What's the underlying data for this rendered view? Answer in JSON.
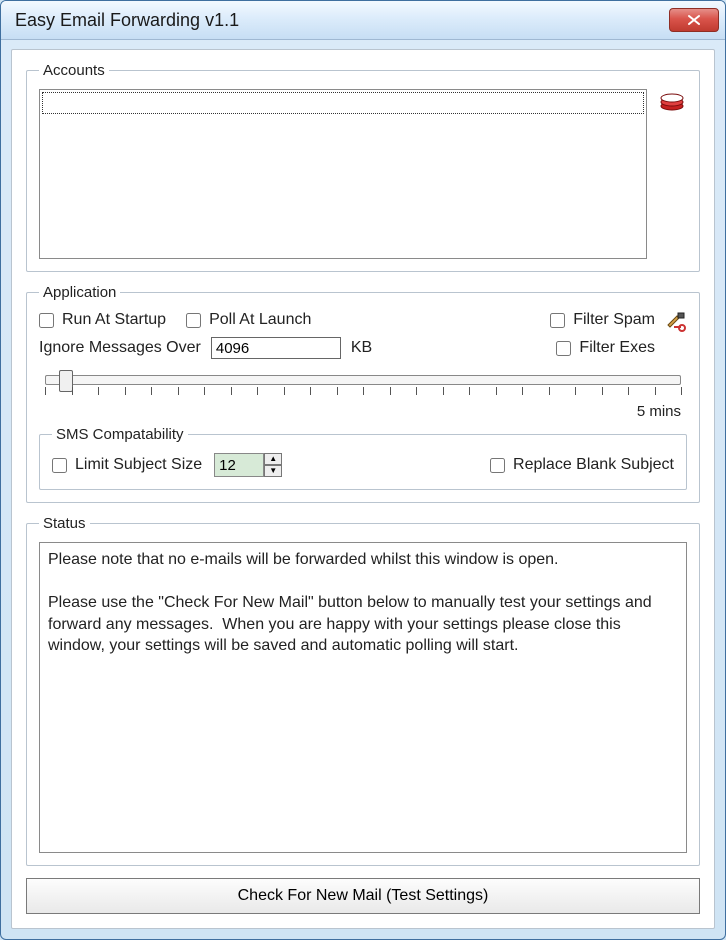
{
  "window": {
    "title": "Easy Email Forwarding v1.1"
  },
  "groups": {
    "accounts": "Accounts",
    "application": "Application",
    "sms": "SMS Compatability",
    "status": "Status"
  },
  "application": {
    "run_at_startup": "Run At Startup",
    "poll_at_launch": "Poll At Launch",
    "filter_spam": "Filter Spam",
    "filter_exes": "Filter Exes",
    "ignore_label": "Ignore Messages Over",
    "ignore_value": "4096",
    "ignore_unit": "KB",
    "slider_label": "5 mins"
  },
  "sms": {
    "limit_subject": "Limit Subject Size",
    "limit_value": "12",
    "replace_blank": "Replace Blank Subject"
  },
  "status": {
    "text": "Please note that no e-mails will be forwarded whilst this window is open.\n\nPlease use the \"Check For New Mail\" button below to manually test your settings and forward any messages.  When you are happy with your settings please close this window, your settings will be saved and automatic polling will start."
  },
  "buttons": {
    "check_mail": "Check For New Mail (Test Settings)"
  },
  "icons": {
    "close": "close-icon",
    "tray": "mail-stack-icon",
    "tools": "hammer-wrench-icon"
  }
}
